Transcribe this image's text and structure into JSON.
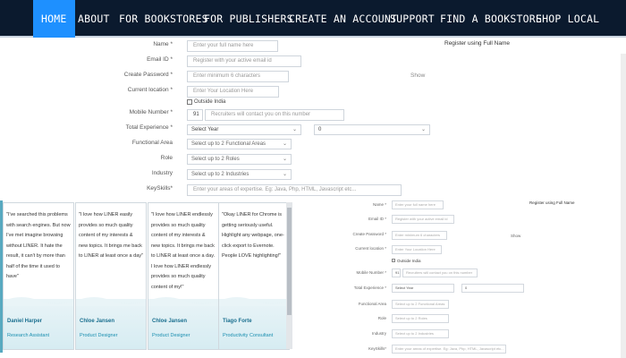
{
  "nav": {
    "items": [
      "HOME",
      "ABOUT",
      "FOR BOOKSTORES",
      "FOR PUBLISHERS",
      "CREATE AN ACCOUNT",
      "SUPPORT",
      "FIND A BOOKSTORE",
      "SHOP LOCAL"
    ]
  },
  "form": {
    "name_label": "Name *",
    "name_placeholder": "Enter your full name here",
    "register_fullname": "Register using Full Name",
    "email_label": "Email ID *",
    "email_placeholder": "Register with your active email id",
    "password_label": "Create Password *",
    "password_placeholder": "Enter minimum 6 characters",
    "show_label": "Show",
    "location_label": "Current location *",
    "location_placeholder": "Enter Your Location Here",
    "outside_india": "Outside India",
    "mobile_label": "Mobile Number *",
    "mobile_code": "91",
    "mobile_placeholder": "Recruiters will contact you on this number",
    "experience_label": "Total Experience *",
    "experience_year": "Select Year",
    "experience_month": "0",
    "functional_label": "Functional Area",
    "functional_value": "Select up to 2 Functional Areas",
    "role_label": "Role",
    "role_value": "Select up to 2 Roles",
    "industry_label": "Industry",
    "industry_value": "Select up to 2 Industries",
    "keyskills_label": "KeySkills*",
    "keyskills_placeholder": "Enter your areas of expertise. Eg: Java, Php, HTML, Javascript etc..."
  },
  "testimonials": [
    {
      "quote": "\"I've searched this problems with search engines. But now I've met imagine browsing without LINER. It hate the result, it can't by more than half of the time it used to have\"",
      "name": "Daniel Harper",
      "role": "Research Assistant"
    },
    {
      "quote": "\"I love how LINER easily provides so much quality content of my interests & new topics. It brings me back to LINER at least once a day\"",
      "name": "Chloe Jansen",
      "role": "Product Designer"
    },
    {
      "quote": "\"I love how LINER endlessly provides so much quality content of my interests & new topics. It brings me back to LINER at least once a day. I love how LINER endlessly provides so much quality content of my!\"",
      "name": "Chloe Jansen",
      "role": "Product Designer"
    },
    {
      "quote": "\"Okay LINER for Chrome is getting seriously useful. Highlight any webpage, one-click export to Evernote. People LOVE highlighting!\"",
      "name": "Tiago Forte",
      "role": "Productivity Consultant"
    }
  ],
  "mini": {
    "name_label": "Name *",
    "name_placeholder": "Enter your full name here",
    "register_fullname": "Register using Full Name",
    "email_label": "Email ID *",
    "email_placeholder": "Register with your active email id",
    "password_label": "Create Password *",
    "password_placeholder": "Enter minimum 6 characters",
    "show_label": "Show",
    "location_label": "Current location *",
    "location_placeholder": "Enter Your Location Here",
    "outside_india": "Outside India",
    "mobile_label": "Mobile Number *",
    "mobile_code": "91",
    "mobile_placeholder": "Recruiters will contact you on this number",
    "experience_label": "Total Experience *",
    "experience_year": "Select Year",
    "experience_month": "0",
    "functional_label": "Functional Area",
    "functional_value": "Select up to 2 Functional Areas",
    "role_label": "Role",
    "role_value": "Select up to 2 Roles",
    "industry_label": "Industry",
    "industry_value": "Select up to 2 Industries",
    "keyskills_label": "KeySkills*",
    "keyskills_placeholder": "Enter your areas of expertise. Eg: Java, Php, HTML, Javascript etc..."
  },
  "colors": {
    "nav_bg": "#0b1a2e",
    "nav_active": "#1e90ff",
    "accent": "#1a8fb0"
  }
}
